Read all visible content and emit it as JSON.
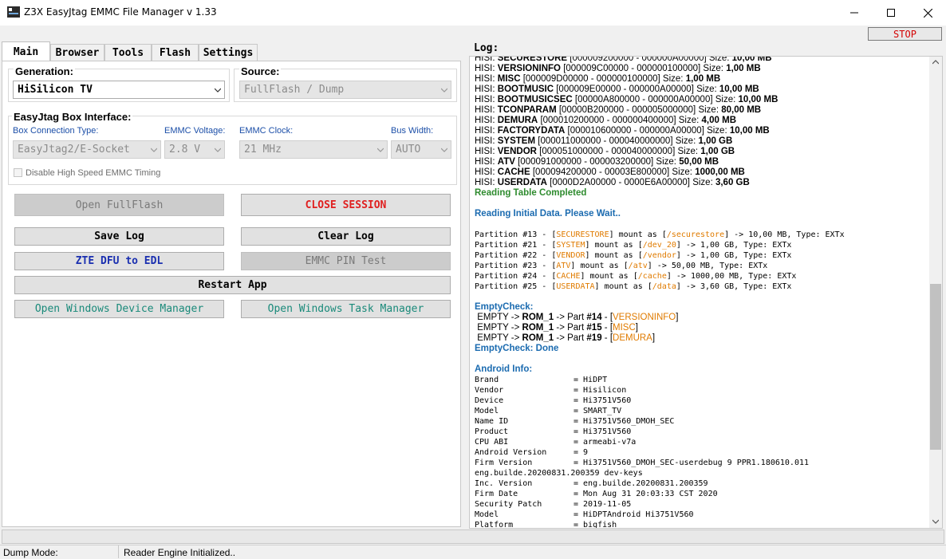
{
  "window": {
    "title": "Z3X EasyJtag EMMC File Manager v 1.33",
    "stop_label": "STOP"
  },
  "tabs": [
    "Main",
    "Browser",
    "Tools",
    "Flash",
    "Settings"
  ],
  "main": {
    "generation_label": "Generation:",
    "generation_value": "HiSilicon TV",
    "source_label": "Source:",
    "source_value": "FullFlash / Dump",
    "box_group_label": "EasyJtag Box Interface:",
    "box_conn_label": "Box Connection Type:",
    "box_conn_value": "EasyJtag2/E-Socket",
    "emmc_voltage_label": "EMMC Voltage:",
    "emmc_voltage_value": "2.8 V",
    "emmc_clock_label": "EMMC Clock:",
    "emmc_clock_value": "21 MHz",
    "bus_width_label": "Bus Width:",
    "bus_width_value": "AUTO",
    "disable_hs_label": "Disable High Speed EMMC Timing",
    "buttons": {
      "open_fullflash": "Open FullFlash",
      "close_session": "CLOSE SESSION",
      "save_log": "Save Log",
      "clear_log": "Clear Log",
      "zte_dfu": "ZTE DFU to EDL",
      "emmc_pin_test": "EMMC PIN Test",
      "restart_app": "Restart App",
      "open_device_manager": "Open Windows Device Manager",
      "open_task_manager": "Open Windows Task Manager"
    }
  },
  "colors": {
    "close_session": "#e02020",
    "zte_dfu": "#1a2fb0",
    "teal": "#1a8a7a",
    "log_green": "#2e8b2e",
    "log_blue": "#1b6bb0",
    "log_orange": "#e07b00"
  },
  "log": {
    "title": "Log:",
    "partitions": [
      {
        "prefix": "HISI: ",
        "name": "SECURESTORE",
        "range": " [000009200000 - 000000A00000]",
        "size_label": " Size: ",
        "size": "10,00 MB"
      },
      {
        "prefix": "HISI: ",
        "name": "VERSIONINFO",
        "range": " [000009C00000 - 000000100000]",
        "size_label": " Size: ",
        "size": "1,00 MB"
      },
      {
        "prefix": "HISI: ",
        "name": "MISC",
        "range": " [000009D00000 - 000000100000]",
        "size_label": " Size: ",
        "size": "1,00 MB"
      },
      {
        "prefix": "HISI: ",
        "name": "BOOTMUSIC",
        "range": " [000009E00000 - 000000A00000]",
        "size_label": " Size: ",
        "size": "10,00 MB"
      },
      {
        "prefix": "HISI: ",
        "name": "BOOTMUSICSEC",
        "range": " [00000A800000 - 000000A00000]",
        "size_label": " Size: ",
        "size": "10,00 MB"
      },
      {
        "prefix": "HISI: ",
        "name": "TCONPARAM",
        "range": " [00000B200000 - 000005000000]",
        "size_label": " Size: ",
        "size": "80,00 MB"
      },
      {
        "prefix": "HISI: ",
        "name": "DEMURA",
        "range": " [000010200000 - 000000400000]",
        "size_label": " Size: ",
        "size": "4,00 MB"
      },
      {
        "prefix": "HISI: ",
        "name": "FACTORYDATA",
        "range": " [000010600000 - 000000A00000]",
        "size_label": " Size: ",
        "size": "10,00 MB"
      },
      {
        "prefix": "HISI: ",
        "name": "SYSTEM",
        "range": " [000011000000 - 000040000000]",
        "size_label": " Size: ",
        "size": "1,00 GB"
      },
      {
        "prefix": "HISI: ",
        "name": "VENDOR",
        "range": " [000051000000 - 000040000000]",
        "size_label": " Size: ",
        "size": "1,00 GB"
      },
      {
        "prefix": "HISI: ",
        "name": "ATV",
        "range": " [000091000000 - 000003200000]",
        "size_label": " Size: ",
        "size": "50,00 MB"
      },
      {
        "prefix": "HISI: ",
        "name": "CACHE",
        "range": " [000094200000 - 00003E800000]",
        "size_label": " Size: ",
        "size": "1000,00 MB"
      },
      {
        "prefix": "HISI: ",
        "name": "USERDATA",
        "range": " [0000D2A00000 - 0000E6A00000]",
        "size_label": " Size: ",
        "size": "3,60 GB"
      }
    ],
    "reading_table_completed": "Reading Table Completed",
    "reading_initial": "Reading Initial Data. Please Wait..",
    "mounts": [
      {
        "part": "Partition #13 - [",
        "name": "SECURESTORE",
        "mid": "] mount as [",
        "path": "/securestore",
        "tail": "] -> 10,00 MB, Type: EXTx"
      },
      {
        "part": "Partition #21 - [",
        "name": "SYSTEM",
        "mid": "] mount as [",
        "path": "/dev_20",
        "tail": "] -> 1,00 GB, Type: EXTx"
      },
      {
        "part": "Partition #22 - [",
        "name": "VENDOR",
        "mid": "] mount as [",
        "path": "/vendor",
        "tail": "] -> 1,00 GB, Type: EXTx"
      },
      {
        "part": "Partition #23 - [",
        "name": "ATV",
        "mid": "] mount as [",
        "path": "/atv",
        "tail": "] -> 50,00 MB, Type: EXTx"
      },
      {
        "part": "Partition #24 - [",
        "name": "CACHE",
        "mid": "] mount as [",
        "path": "/cache",
        "tail": "] -> 1000,00 MB, Type: EXTx"
      },
      {
        "part": "Partition #25 - [",
        "name": "USERDATA",
        "mid": "] mount as [",
        "path": "/data",
        "tail": "] -> 3,60 GB, Type: EXTx"
      }
    ],
    "empty_check_title": "EmptyCheck:",
    "empty_checks": [
      {
        "pre": "EMPTY -> ",
        "rom": "ROM_1",
        "mid": " -> Part ",
        "num": "#14",
        "sep": " - [",
        "name": "VERSIONINFO",
        "end": "]"
      },
      {
        "pre": "EMPTY -> ",
        "rom": "ROM_1",
        "mid": " -> Part ",
        "num": "#15",
        "sep": " - [",
        "name": "MISC",
        "end": "]"
      },
      {
        "pre": "EMPTY -> ",
        "rom": "ROM_1",
        "mid": " -> Part ",
        "num": "#19",
        "sep": " - [",
        "name": "DEMURA",
        "end": "]"
      }
    ],
    "empty_check_done": "EmptyCheck: Done",
    "android_info_title": "Android Info:",
    "android_info": [
      {
        "key": "Brand",
        "value": "= HiDPT"
      },
      {
        "key": "Vendor",
        "value": "= Hisilicon"
      },
      {
        "key": "Device",
        "value": "= Hi3751V560"
      },
      {
        "key": "Model",
        "value": "= SMART_TV"
      },
      {
        "key": "Name ID",
        "value": "= Hi3751V560_DMOH_SEC"
      },
      {
        "key": "Product",
        "value": "= Hi3751V560"
      },
      {
        "key": "CPU ABI",
        "value": "= armeabi-v7a"
      },
      {
        "key": "Android Version",
        "value": "= 9"
      },
      {
        "key": "Firm Version",
        "value": "= Hi3751V560_DMOH_SEC-userdebug 9 PPR1.180610.011"
      },
      {
        "key": "eng.builde.20200831.200359 dev-keys",
        "value": ""
      },
      {
        "key": "Inc. Version",
        "value": "= eng.builde.20200831.200359"
      },
      {
        "key": "Firm Date",
        "value": "= Mon Aug 31 20:03:33 CST 2020"
      },
      {
        "key": "Security Patch",
        "value": "= 2019-11-05"
      },
      {
        "key": "Model",
        "value": "= HiDPTAndroid Hi3751V560"
      },
      {
        "key": "Platform",
        "value": "= bigfish"
      }
    ]
  },
  "status": {
    "dump_mode_label": "Dump Mode:",
    "message": "Reader Engine Initialized.."
  }
}
